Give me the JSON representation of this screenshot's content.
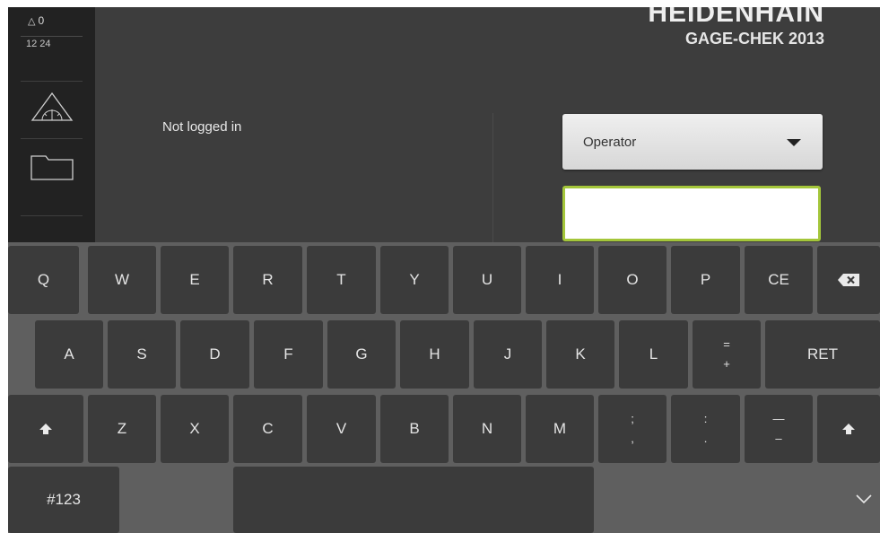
{
  "status": {
    "delta_count": "0",
    "time": "12 24"
  },
  "header": {
    "brand": "HEIDENHAIN",
    "product": "GAGE-CHEK 2013"
  },
  "login": {
    "status": "Not logged in",
    "user_select": "Operator",
    "password_placeholder": ""
  },
  "keyboard": {
    "row1": [
      "Q",
      "W",
      "E",
      "R",
      "T",
      "Y",
      "U",
      "I",
      "O",
      "P",
      "CE"
    ],
    "row2": [
      "A",
      "S",
      "D",
      "F",
      "G",
      "H",
      "J",
      "K",
      "L"
    ],
    "row2_dual": {
      "top": "=",
      "bottom": "+"
    },
    "ret": "RET",
    "row3": [
      "Z",
      "X",
      "C",
      "V",
      "B",
      "N",
      "M"
    ],
    "row3_dual": [
      {
        "top": ";",
        "bottom": ","
      },
      {
        "top": ":",
        "bottom": "."
      },
      {
        "top": "—",
        "bottom": "–"
      }
    ],
    "mode": "#123"
  },
  "icons": {
    "delta": "delta-icon",
    "measure": "protractor-icon",
    "files": "folder-icon",
    "backspace": "backspace-icon",
    "shift": "shift-arrow-icon",
    "hide": "chevron-down-icon"
  }
}
